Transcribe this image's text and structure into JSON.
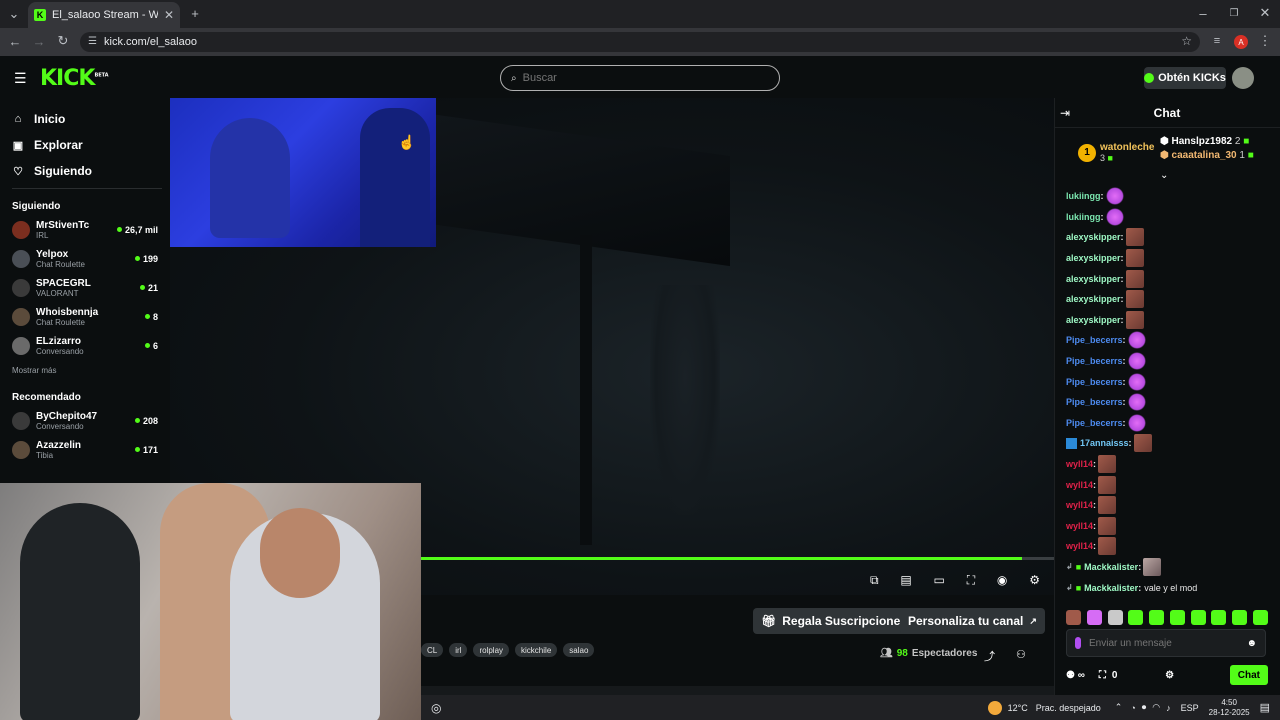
{
  "browser": {
    "tab_title": "El_salaoo Stream - Watch Li",
    "url": "kick.com/el_salaoo",
    "profile_initial": "A"
  },
  "header": {
    "logo": "KICK",
    "logo_beta": "BETA",
    "search_placeholder": "Buscar",
    "get_kicks_label": "Obtén KICKs"
  },
  "sidebar": {
    "nav": [
      {
        "label": "Inicio"
      },
      {
        "label": "Explorar"
      },
      {
        "label": "Siguiendo"
      }
    ],
    "following_title": "Siguiendo",
    "following": [
      {
        "name": "MrStivenTc",
        "category": "IRL",
        "viewers": "26,7 mil"
      },
      {
        "name": "Yelpox",
        "category": "Chat Roulette",
        "viewers": "199"
      },
      {
        "name": "SPACEGRL",
        "category": "VALORANT",
        "viewers": "21"
      },
      {
        "name": "Whoisbennja",
        "category": "Chat Roulette",
        "viewers": "8"
      },
      {
        "name": "ELzizarro",
        "category": "Conversando",
        "viewers": "6"
      }
    ],
    "show_more": "Mostrar más",
    "recommended_title": "Recomendado",
    "recommended": [
      {
        "name": "ByChepito47",
        "category": "Conversando",
        "viewers": "208"
      },
      {
        "name": "Azazzelin",
        "category": "Tibia",
        "viewers": "171"
      }
    ]
  },
  "player": {
    "progress_fraction": 0.95
  },
  "below_video": {
    "gift_label": "Regala Suscripciones",
    "customize_label": "Personaliza tu canal",
    "tags": [
      "CL",
      "irl",
      "rolplay",
      "kickchile",
      "salao"
    ],
    "viewer_count": "98",
    "viewer_label": "Espectadores"
  },
  "chat": {
    "title": "Chat",
    "leaderboard": {
      "top": {
        "rank": "1",
        "name": "watonleche",
        "count": "3"
      },
      "others": [
        {
          "name": "Hanslpz1982",
          "count": "2"
        },
        {
          "name": "caaatalina_30",
          "count": "1"
        }
      ]
    },
    "messages": [
      {
        "user": "lukiingg",
        "color": "#7ce8b0",
        "emotes": [
          "pink"
        ],
        "text": ""
      },
      {
        "user": "lukiingg",
        "color": "#7ce8b0",
        "emotes": [
          "pink"
        ],
        "text": ""
      },
      {
        "user": "alexyskipper",
        "color": "#9ef7c4",
        "emotes": [
          "brown"
        ],
        "text": ""
      },
      {
        "user": "alexyskipper",
        "color": "#9ef7c4",
        "emotes": [
          "brown"
        ],
        "text": ""
      },
      {
        "user": "alexyskipper",
        "color": "#9ef7c4",
        "emotes": [
          "brown"
        ],
        "text": ""
      },
      {
        "user": "alexyskipper",
        "color": "#9ef7c4",
        "emotes": [
          "brown"
        ],
        "text": ""
      },
      {
        "user": "alexyskipper",
        "color": "#9ef7c4",
        "emotes": [
          "brown"
        ],
        "text": ""
      },
      {
        "user": "Pipe_becerrs",
        "color": "#4d8bf0",
        "emotes": [
          "pink"
        ],
        "text": ""
      },
      {
        "user": "Pipe_becerrs",
        "color": "#4d8bf0",
        "emotes": [
          "pink"
        ],
        "text": ""
      },
      {
        "user": "Pipe_becerrs",
        "color": "#4d8bf0",
        "emotes": [
          "pink"
        ],
        "text": ""
      },
      {
        "user": "Pipe_becerrs",
        "color": "#4d8bf0",
        "emotes": [
          "pink"
        ],
        "text": ""
      },
      {
        "user": "Pipe_becerrs",
        "color": "#4d8bf0",
        "emotes": [
          "pink"
        ],
        "text": ""
      },
      {
        "user": "17annaisss",
        "color": "#72c7f5",
        "emotes": [
          "brown"
        ],
        "text": "",
        "badge": "sub"
      },
      {
        "user": "wyll14",
        "color": "#e0224a",
        "emotes": [
          "brown"
        ],
        "text": ""
      },
      {
        "user": "wyll14",
        "color": "#e0224a",
        "emotes": [
          "brown"
        ],
        "text": ""
      },
      {
        "user": "wyll14",
        "color": "#e0224a",
        "emotes": [
          "brown"
        ],
        "text": ""
      },
      {
        "user": "wyll14",
        "color": "#e0224a",
        "emotes": [
          "brown"
        ],
        "text": ""
      },
      {
        "user": "wyll14",
        "color": "#e0224a",
        "emotes": [
          "brown"
        ],
        "text": ""
      },
      {
        "user": "Mackkalister",
        "color": "#9ef7c4",
        "emotes": [
          "gray"
        ],
        "text": "",
        "badge": "gift"
      },
      {
        "user": "Mackkalister",
        "color": "#9ef7c4",
        "emotes": [],
        "text": "vale y el mod",
        "badge": "gift"
      }
    ],
    "input_placeholder": "Enviar un mensaje",
    "kicks_count": "0",
    "send_label": "Chat"
  },
  "taskbar": {
    "weather": "12°C",
    "weather_desc": "Prac. despejado",
    "language": "ESP",
    "time": "4:50",
    "date": "28-12-2025"
  }
}
